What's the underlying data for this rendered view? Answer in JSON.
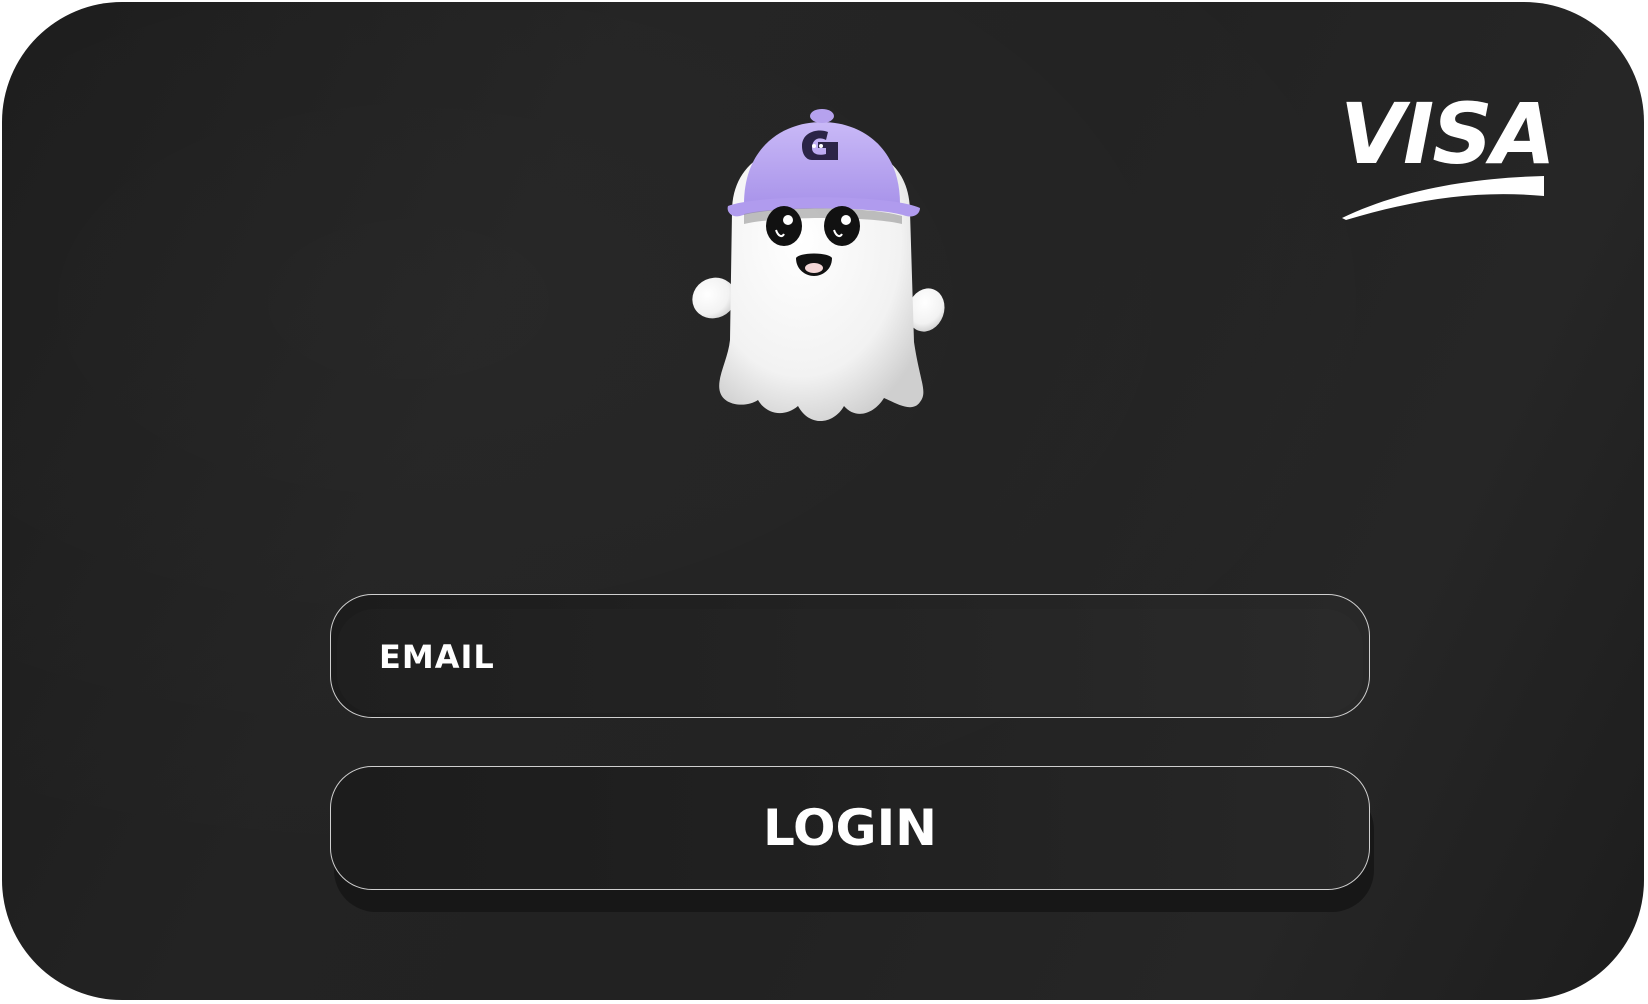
{
  "brand": {
    "name": "VISA",
    "logo_icon": "visa-logo",
    "text_color": "#ffffff"
  },
  "mascot": {
    "icon": "ghost-with-cap-icon",
    "cap_color": "#b8a6f0"
  },
  "form": {
    "email_label": "EMAIL",
    "email_value": "",
    "login_label": "LOGIN"
  },
  "colors": {
    "card_background": "#222222",
    "border": "#cfcfcf",
    "text": "#ffffff"
  }
}
